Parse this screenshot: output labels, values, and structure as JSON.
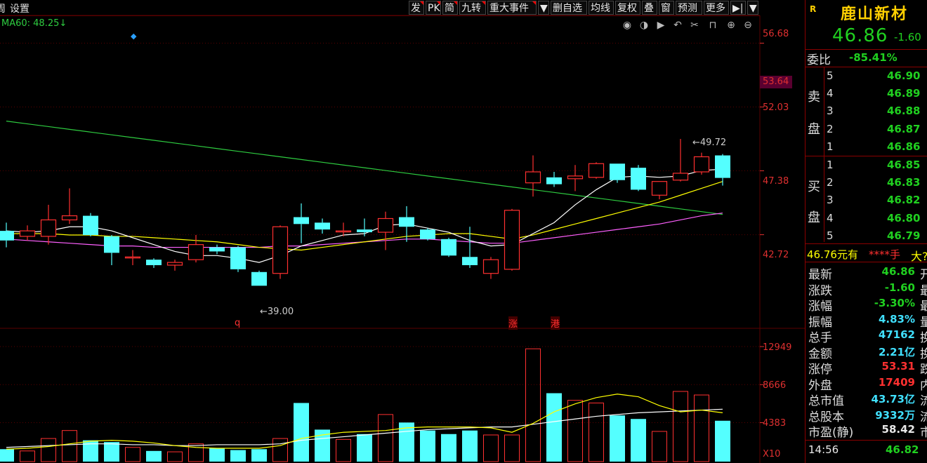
{
  "toolbar": {
    "left_items": [
      "周",
      "设置"
    ],
    "buttons": [
      "发",
      "PK",
      "简",
      "九转",
      "重大事件",
      "▼",
      "删自选",
      "均线",
      "复权",
      "叠",
      "窗",
      "预测",
      "更多",
      "▶|",
      "▼"
    ]
  },
  "ma_label": "MA60: 48.25↓",
  "chart_icons": [
    "eye-icon",
    "play-back-icon",
    "play-icon",
    "undo-icon",
    "scissors-icon",
    "lock-icon",
    "zoom-in-icon",
    "zoom-out-icon"
  ],
  "price_axis": [
    "56.68",
    "53.64",
    "52.03",
    "47.38",
    "42.72"
  ],
  "volume_axis": [
    "12949",
    "8666",
    "4383",
    "X10"
  ],
  "markers": {
    "high": "49.72",
    "low": "39.00",
    "q": "q",
    "zhang": "涨",
    "gang": "港"
  },
  "colors": {
    "up": "#ff3030",
    "down": "#54ffff",
    "ma5": "#ffffff",
    "ma10": "#ffff00",
    "ma20": "#ff60ff",
    "ma60": "#2ecc40",
    "grid": "#5a0000"
  },
  "panel": {
    "badge": "R",
    "name": "鹿山新材",
    "price": "46.86",
    "change": "-1.60",
    "weibi_label": "委比",
    "weibi_value": "-85.41%",
    "sell_label": [
      "卖",
      "盘"
    ],
    "sell": [
      {
        "level": "5",
        "price": "46.90"
      },
      {
        "level": "4",
        "price": "46.89"
      },
      {
        "level": "3",
        "price": "46.88"
      },
      {
        "level": "2",
        "price": "46.87"
      },
      {
        "level": "1",
        "price": "46.86"
      }
    ],
    "buy_label": [
      "买",
      "盘"
    ],
    "buy": [
      {
        "level": "1",
        "price": "46.85"
      },
      {
        "level": "2",
        "price": "46.83"
      },
      {
        "level": "3",
        "price": "46.82"
      },
      {
        "level": "4",
        "price": "46.80"
      },
      {
        "level": "5",
        "price": "46.79"
      }
    ],
    "deal_left": "46.76元有",
    "deal_mid": "****手",
    "deal_right": "大?",
    "stats": [
      {
        "label": "最新",
        "value": "46.86",
        "color": "grn",
        "cut": "开"
      },
      {
        "label": "涨跌",
        "value": "-1.60",
        "color": "grn",
        "cut": "最"
      },
      {
        "label": "涨幅",
        "value": "-3.30%",
        "color": "grn",
        "cut": "最"
      },
      {
        "label": "振幅",
        "value": "4.83%",
        "color": "cyan",
        "cut": "量"
      },
      {
        "label": "总手",
        "value": "47162",
        "color": "cyan",
        "cut": "换"
      },
      {
        "label": "金额",
        "value": "2.21亿",
        "color": "cyan",
        "cut": "换"
      },
      {
        "label": "涨停",
        "value": "53.31",
        "color": "red",
        "cut": "跌"
      },
      {
        "label": "外盘",
        "value": "17409",
        "color": "red",
        "cut": "内"
      },
      {
        "label": "总市值",
        "value": "43.73亿",
        "color": "cyan",
        "cut": "流"
      },
      {
        "label": "总股本",
        "value": "9332万",
        "color": "cyan",
        "cut": "流"
      },
      {
        "label": "市盈(静)",
        "value": "58.42",
        "color": "wht",
        "cut": "市"
      }
    ],
    "time": "14:56",
    "time_price": "46.82"
  },
  "chart_data": {
    "type": "candlestick",
    "price_range": [
      36.0,
      58.6
    ],
    "volume_range": [
      0,
      13900
    ],
    "candles": [
      {
        "o": 43.0,
        "c": 42.3,
        "h": 43.6,
        "l": 41.8,
        "v": 1400
      },
      {
        "o": 42.6,
        "c": 43.0,
        "h": 43.4,
        "l": 42.3,
        "v": 1200
      },
      {
        "o": 42.6,
        "c": 43.8,
        "h": 44.9,
        "l": 42.0,
        "v": 2600
      },
      {
        "o": 43.8,
        "c": 44.1,
        "h": 46.1,
        "l": 43.5,
        "v": 3500
      },
      {
        "o": 44.1,
        "c": 42.7,
        "h": 44.3,
        "l": 42.6,
        "v": 2400
      },
      {
        "o": 42.6,
        "c": 41.4,
        "h": 42.7,
        "l": 40.5,
        "v": 2200
      },
      {
        "o": 41.1,
        "c": 41.1,
        "h": 41.6,
        "l": 40.5,
        "v": 1600
      },
      {
        "o": 40.9,
        "c": 40.5,
        "h": 41.0,
        "l": 40.3,
        "v": 1200
      },
      {
        "o": 40.5,
        "c": 40.7,
        "h": 40.9,
        "l": 40.1,
        "v": 1100
      },
      {
        "o": 40.9,
        "c": 42.0,
        "h": 42.7,
        "l": 40.7,
        "v": 2000
      },
      {
        "o": 41.8,
        "c": 41.5,
        "h": 42.0,
        "l": 41.3,
        "v": 1500
      },
      {
        "o": 41.8,
        "c": 40.2,
        "h": 41.9,
        "l": 40.0,
        "v": 1300
      },
      {
        "o": 40.0,
        "c": 39.0,
        "h": 40.1,
        "l": 39.0,
        "v": 1400
      },
      {
        "o": 39.9,
        "c": 43.3,
        "h": 43.4,
        "l": 39.5,
        "v": 2600
      },
      {
        "o": 44.0,
        "c": 43.5,
        "h": 45.0,
        "l": 42.1,
        "v": 6600
      },
      {
        "o": 43.6,
        "c": 43.1,
        "h": 43.9,
        "l": 42.8,
        "v": 3600
      },
      {
        "o": 43.0,
        "c": 43.0,
        "h": 43.6,
        "l": 42.6,
        "v": 2500
      },
      {
        "o": 43.1,
        "c": 42.9,
        "h": 43.9,
        "l": 42.6,
        "v": 3100
      },
      {
        "o": 42.9,
        "c": 43.9,
        "h": 44.4,
        "l": 41.6,
        "v": 5300
      },
      {
        "o": 44.0,
        "c": 43.3,
        "h": 44.8,
        "l": 42.2,
        "v": 4400
      },
      {
        "o": 43.1,
        "c": 42.4,
        "h": 43.2,
        "l": 42.3,
        "v": 3500
      },
      {
        "o": 42.4,
        "c": 41.2,
        "h": 42.5,
        "l": 41.1,
        "v": 3100
      },
      {
        "o": 41.1,
        "c": 40.5,
        "h": 43.3,
        "l": 40.3,
        "v": 3500
      },
      {
        "o": 39.9,
        "c": 40.9,
        "h": 41.1,
        "l": 39.5,
        "v": 3000
      },
      {
        "o": 40.2,
        "c": 44.5,
        "h": 44.6,
        "l": 40.1,
        "v": 3000
      },
      {
        "o": 46.5,
        "c": 47.3,
        "h": 48.5,
        "l": 45.5,
        "v": 12700
      },
      {
        "o": 46.9,
        "c": 46.4,
        "h": 47.3,
        "l": 46.2,
        "v": 7700
      },
      {
        "o": 46.8,
        "c": 47.0,
        "h": 47.8,
        "l": 45.9,
        "v": 6900
      },
      {
        "o": 46.9,
        "c": 47.9,
        "h": 48.0,
        "l": 46.8,
        "v": 6600
      },
      {
        "o": 47.9,
        "c": 46.7,
        "h": 47.9,
        "l": 46.5,
        "v": 5200
      },
      {
        "o": 47.6,
        "c": 46.0,
        "h": 47.8,
        "l": 45.9,
        "v": 4800
      },
      {
        "o": 45.6,
        "c": 46.6,
        "h": 46.6,
        "l": 45.3,
        "v": 3400
      },
      {
        "o": 46.7,
        "c": 47.2,
        "h": 49.7,
        "l": 46.6,
        "v": 7900
      },
      {
        "o": 47.3,
        "c": 48.4,
        "h": 48.7,
        "l": 47.1,
        "v": 7500
      },
      {
        "o": 48.5,
        "c": 46.86,
        "h": 48.6,
        "l": 46.3,
        "v": 4600
      }
    ],
    "ma5": [
      43.0,
      42.9,
      43.0,
      43.3,
      43.3,
      43.0,
      42.5,
      42.0,
      41.5,
      41.2,
      41.2,
      41.0,
      40.7,
      41.2,
      41.9,
      42.3,
      42.7,
      42.8,
      43.4,
      43.5,
      43.2,
      42.9,
      42.3,
      41.9,
      42.0,
      42.8,
      43.6,
      44.9,
      46.0,
      46.9,
      47.0,
      46.9,
      47.0,
      47.4,
      47.5
    ],
    "ma10": [
      42.8,
      42.8,
      42.8,
      42.7,
      42.7,
      42.6,
      42.6,
      42.5,
      42.4,
      42.3,
      42.2,
      42.0,
      41.8,
      41.7,
      41.6,
      41.8,
      42.0,
      42.2,
      42.4,
      42.6,
      42.7,
      42.8,
      42.8,
      42.6,
      42.4,
      42.7,
      43.1,
      43.5,
      43.9,
      44.3,
      44.7,
      45.1,
      45.6,
      46.1,
      46.6
    ],
    "ma20": [
      42.4,
      42.3,
      42.2,
      42.1,
      42.0,
      41.9,
      41.9,
      41.8,
      41.8,
      41.8,
      41.8,
      41.8,
      41.8,
      41.9,
      41.9,
      42.0,
      42.1,
      42.2,
      42.3,
      42.4,
      42.4,
      42.3,
      42.2,
      42.1,
      42.1,
      42.3,
      42.5,
      42.7,
      42.9,
      43.1,
      43.3,
      43.5,
      43.8,
      44.1,
      44.3
    ],
    "ma60": [
      51.0,
      50.8,
      50.6,
      50.4,
      50.2,
      50.0,
      49.8,
      49.6,
      49.4,
      49.2,
      49.0,
      48.8,
      48.6,
      48.4,
      48.2,
      48.0,
      47.8,
      47.6,
      47.4,
      47.2,
      47.0,
      46.8,
      46.6,
      46.4,
      46.2,
      46.0,
      45.8,
      45.6,
      45.4,
      45.2,
      45.0,
      44.8,
      44.6,
      44.4,
      44.2
    ],
    "vol_ma_white": [
      1600,
      1700,
      1800,
      1900,
      2000,
      2000,
      1900,
      1900,
      1800,
      1800,
      1900,
      1900,
      1900,
      2000,
      2400,
      2600,
      2800,
      3000,
      3200,
      3400,
      3600,
      3700,
      3800,
      3900,
      3900,
      4200,
      4500,
      4800,
      5100,
      5300,
      5500,
      5600,
      5700,
      5800,
      5900
    ],
    "vol_ma_yellow": [
      1400,
      1500,
      1700,
      2000,
      2300,
      2400,
      2300,
      2100,
      1800,
      1600,
      1500,
      1500,
      1500,
      1800,
      2600,
      3000,
      3300,
      3400,
      3500,
      3800,
      3900,
      3900,
      3900,
      3800,
      3300,
      4300,
      5600,
      6500,
      7200,
      7600,
      7300,
      6300,
      5600,
      5800,
      5500
    ]
  }
}
